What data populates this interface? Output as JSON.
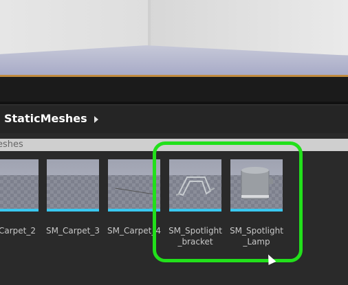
{
  "path_bar": {
    "current_folder": "StaticMeshes"
  },
  "section_header": {
    "label": "eshes"
  },
  "assets": [
    {
      "label": "_Carpet_2"
    },
    {
      "label": "SM_Carpet_3"
    },
    {
      "label": "SM_Carpet_4"
    },
    {
      "label": "SM_Spotlight\n_bracket"
    },
    {
      "label": "SM_Spotlight\n_Lamp"
    }
  ],
  "colors": {
    "accent_bar": "#39c8f0",
    "highlight": "#22e01b",
    "viewport_edge": "#c08a3e"
  }
}
